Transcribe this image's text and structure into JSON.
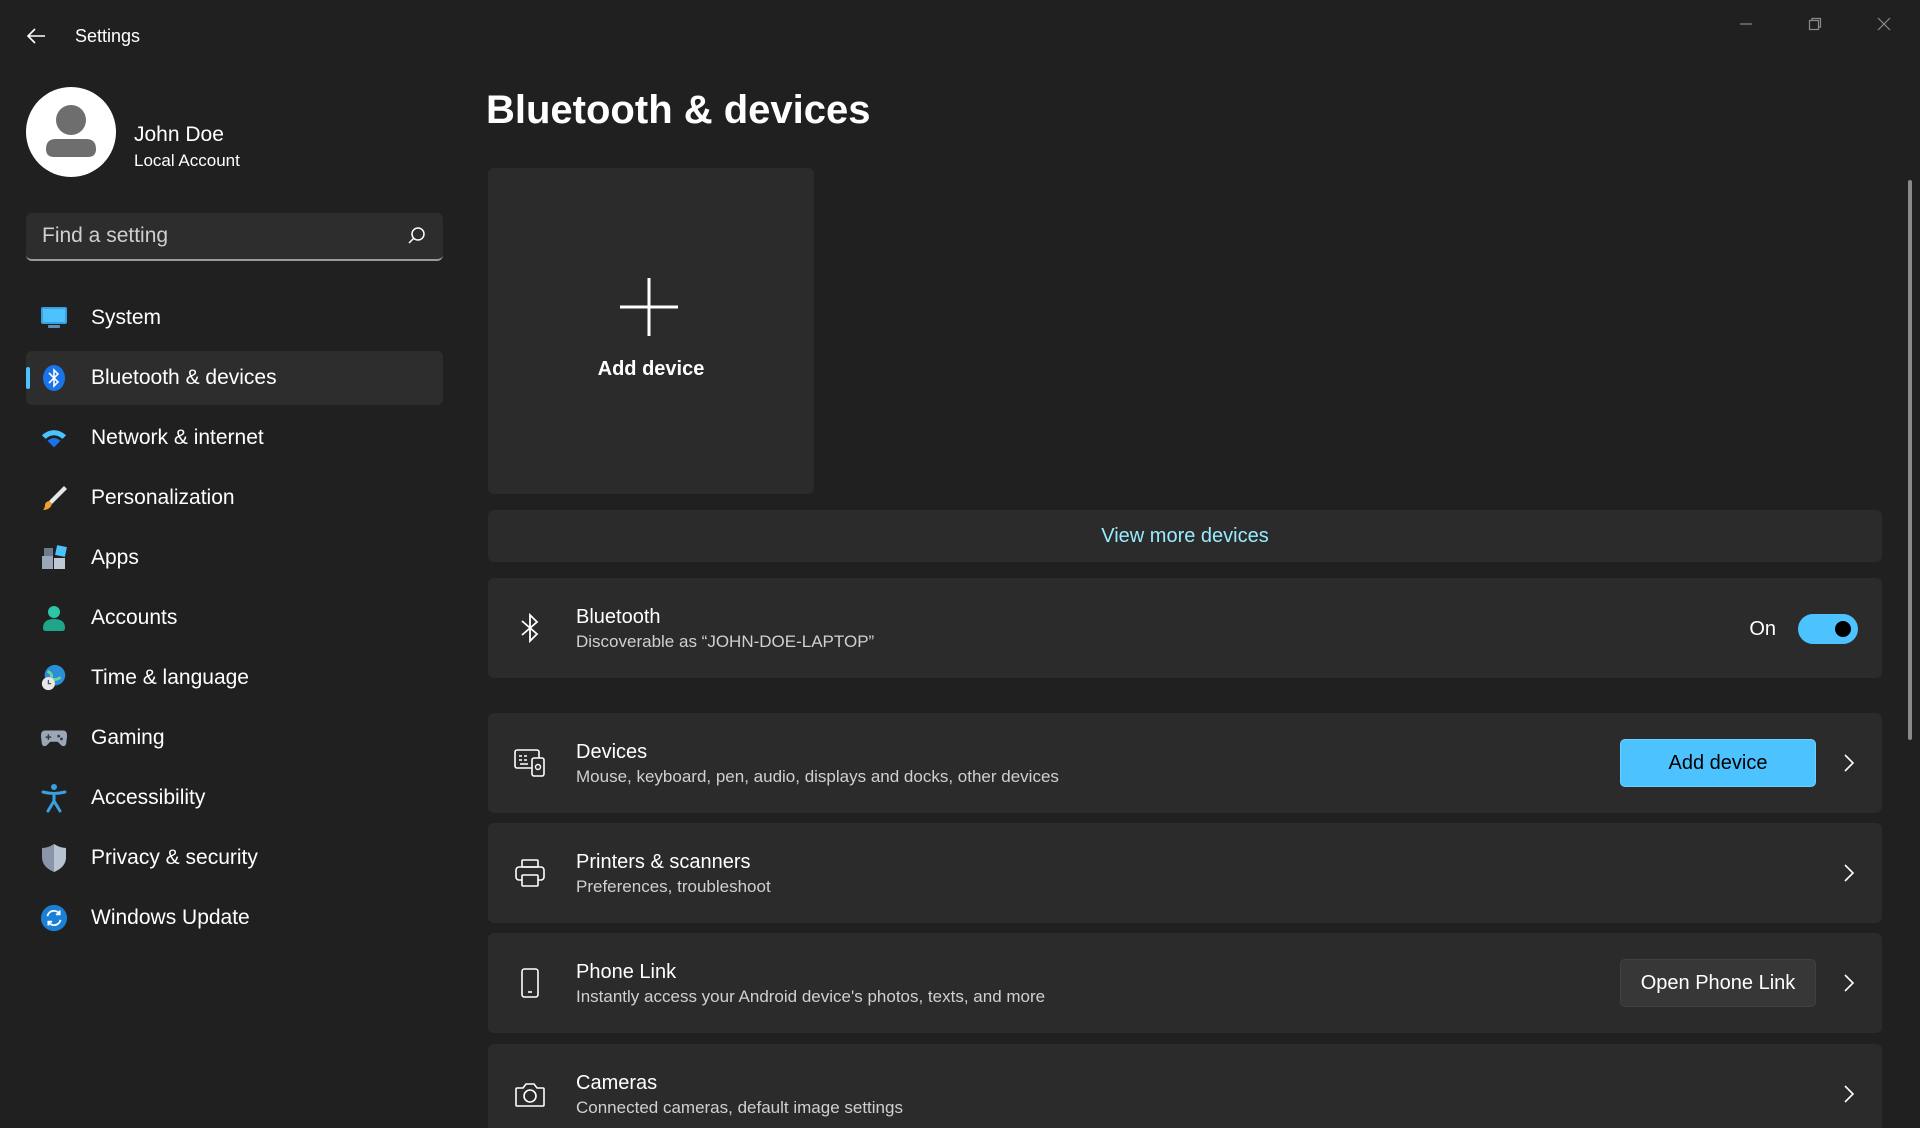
{
  "window": {
    "title": "Settings"
  },
  "profile": {
    "name": "John Doe",
    "account_type": "Local Account"
  },
  "search": {
    "placeholder": "Find a setting"
  },
  "sidebar": {
    "items": [
      {
        "label": "System",
        "icon": "system-icon",
        "active": false
      },
      {
        "label": "Bluetooth & devices",
        "icon": "bluetooth-icon",
        "active": true
      },
      {
        "label": "Network & internet",
        "icon": "wifi-icon",
        "active": false
      },
      {
        "label": "Personalization",
        "icon": "brush-icon",
        "active": false
      },
      {
        "label": "Apps",
        "icon": "apps-icon",
        "active": false
      },
      {
        "label": "Accounts",
        "icon": "accounts-icon",
        "active": false
      },
      {
        "label": "Time & language",
        "icon": "globe-clock-icon",
        "active": false
      },
      {
        "label": "Gaming",
        "icon": "gamepad-icon",
        "active": false
      },
      {
        "label": "Accessibility",
        "icon": "accessibility-icon",
        "active": false
      },
      {
        "label": "Privacy & security",
        "icon": "shield-icon",
        "active": false
      },
      {
        "label": "Windows Update",
        "icon": "update-icon",
        "active": false
      }
    ]
  },
  "main": {
    "title": "Bluetooth & devices",
    "add_tile_label": "Add device",
    "view_more": "View more devices",
    "bluetooth": {
      "title": "Bluetooth",
      "subtitle": "Discoverable as “JOHN-DOE-LAPTOP”",
      "state_label": "On",
      "enabled": true
    },
    "devices": {
      "title": "Devices",
      "subtitle": "Mouse, keyboard, pen, audio, displays and docks, other devices",
      "button": "Add device"
    },
    "printers": {
      "title": "Printers & scanners",
      "subtitle": "Preferences, troubleshoot"
    },
    "phone_link": {
      "title": "Phone Link",
      "subtitle": "Instantly access your Android device's photos, texts, and more",
      "button": "Open Phone Link"
    },
    "cameras": {
      "title": "Cameras",
      "subtitle": "Connected cameras, default image settings"
    }
  },
  "colors": {
    "background": "#202020",
    "card": "#2b2b2b",
    "accent": "#4cc2ff",
    "link": "#99ebff"
  }
}
